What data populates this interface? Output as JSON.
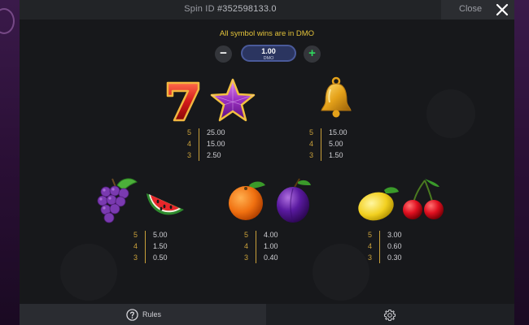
{
  "header": {
    "spin_label": "Spin ID",
    "spin_id": "#352598133.0",
    "close_label": "Close"
  },
  "info": {
    "currency_note": "All symbol wins are in DMO"
  },
  "bet": {
    "value": "1.00",
    "currency": "DMO",
    "minus_label": "−",
    "plus_label": "+"
  },
  "paytables": [
    {
      "symbols": [
        "seven-icon",
        "star-icon"
      ],
      "rows": [
        {
          "count": "5",
          "value": "25.00"
        },
        {
          "count": "4",
          "value": "15.00"
        },
        {
          "count": "3",
          "value": "2.50"
        }
      ]
    },
    {
      "symbols": [
        "bell-icon"
      ],
      "rows": [
        {
          "count": "5",
          "value": "15.00"
        },
        {
          "count": "4",
          "value": "5.00"
        },
        {
          "count": "3",
          "value": "1.50"
        }
      ]
    },
    {
      "symbols": [
        "grapes-icon",
        "watermelon-icon"
      ],
      "rows": [
        {
          "count": "5",
          "value": "5.00"
        },
        {
          "count": "4",
          "value": "1.50"
        },
        {
          "count": "3",
          "value": "0.50"
        }
      ]
    },
    {
      "symbols": [
        "orange-icon",
        "plum-icon"
      ],
      "rows": [
        {
          "count": "5",
          "value": "4.00"
        },
        {
          "count": "4",
          "value": "1.00"
        },
        {
          "count": "3",
          "value": "0.40"
        }
      ]
    },
    {
      "symbols": [
        "lemon-icon",
        "cherries-icon"
      ],
      "rows": [
        {
          "count": "5",
          "value": "3.00"
        },
        {
          "count": "4",
          "value": "0.60"
        },
        {
          "count": "3",
          "value": "0.30"
        }
      ]
    }
  ],
  "footer": {
    "rules_label": "Rules"
  },
  "colors": {
    "accent_gold": "#c9a03a",
    "info_yellow": "#e2c23a",
    "plus_green": "#2fd85e"
  }
}
